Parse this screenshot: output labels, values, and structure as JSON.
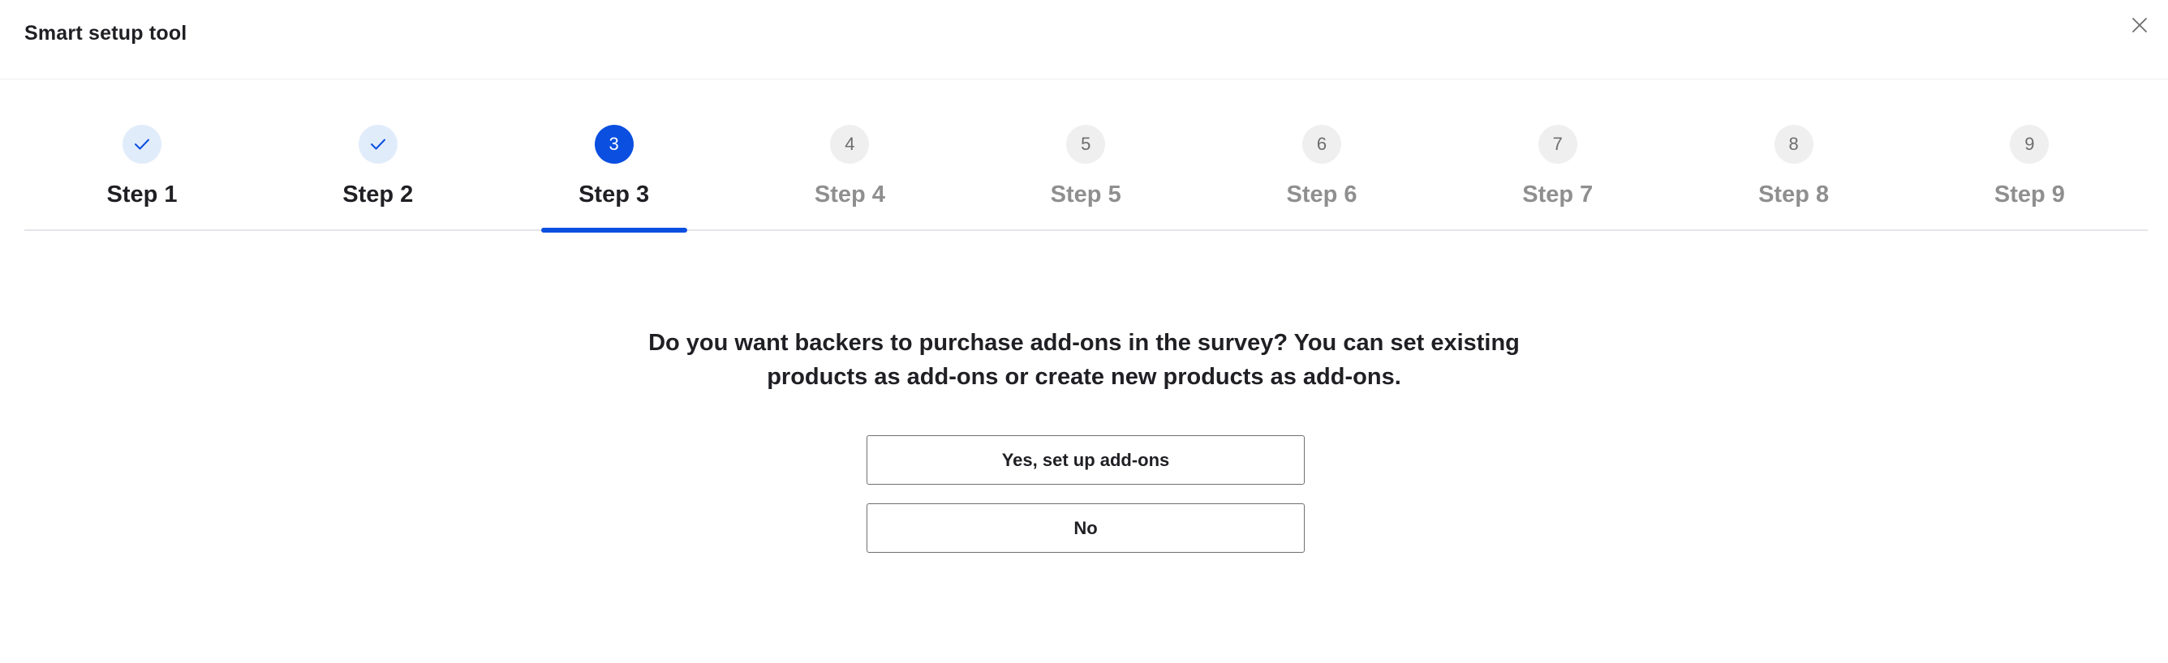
{
  "modal": {
    "title": "Smart setup tool",
    "close_icon": "close-icon"
  },
  "stepper": {
    "active_index": 2,
    "steps": [
      {
        "label": "Step 1",
        "number": "1",
        "status": "done",
        "icon": "check-icon"
      },
      {
        "label": "Step 2",
        "number": "2",
        "status": "done",
        "icon": "check-icon"
      },
      {
        "label": "Step 3",
        "number": "3",
        "status": "active"
      },
      {
        "label": "Step 4",
        "number": "4",
        "status": "pending"
      },
      {
        "label": "Step 5",
        "number": "5",
        "status": "pending"
      },
      {
        "label": "Step 6",
        "number": "6",
        "status": "pending"
      },
      {
        "label": "Step 7",
        "number": "7",
        "status": "pending"
      },
      {
        "label": "Step 8",
        "number": "8",
        "status": "pending"
      },
      {
        "label": "Step 9",
        "number": "9",
        "status": "pending"
      }
    ]
  },
  "content": {
    "question_line1": "Do you want backers to purchase add-ons in the survey? You can set existing",
    "question_line2": "products as add-ons or create new products as add-ons.",
    "yes_label": "Yes, set up add-ons",
    "no_label": "No"
  },
  "colors": {
    "accent": "#0b4fe0",
    "done_circle": "#e1ecfb",
    "pending_circle": "#efefef",
    "pending_text": "#8f8f8f",
    "text": "#1f1f24"
  }
}
